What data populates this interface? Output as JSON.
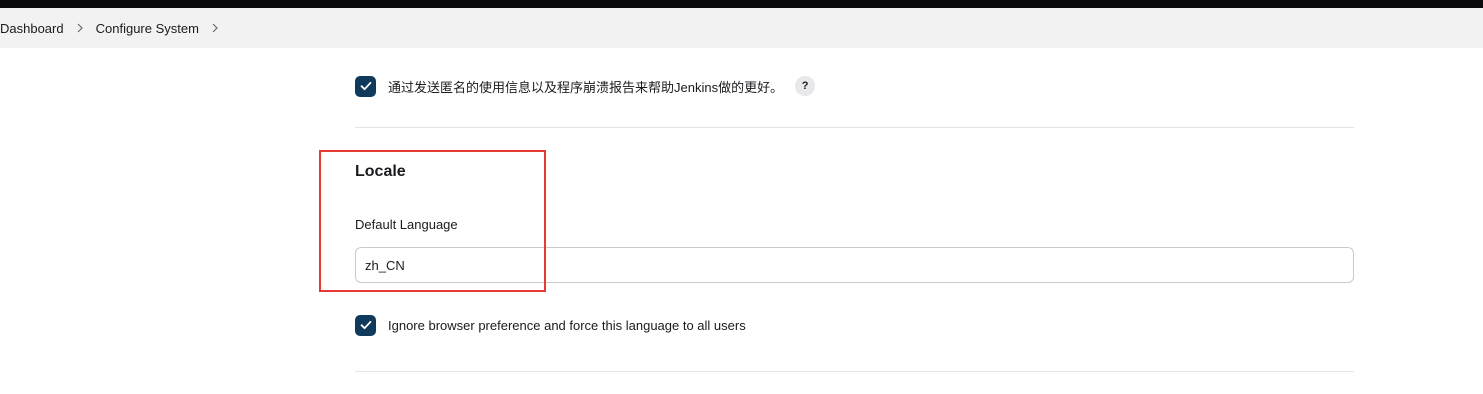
{
  "breadcrumb": {
    "items": [
      {
        "label": "Dashboard"
      },
      {
        "label": "Configure System"
      }
    ]
  },
  "usage_stats": {
    "label": "通过发送匿名的使用信息以及程序崩溃报告来帮助Jenkins做的更好。",
    "checked": true,
    "help_label": "?"
  },
  "locale": {
    "title": "Locale",
    "default_language_label": "Default Language",
    "default_language_value": "zh_CN",
    "ignore_browser_label": "Ignore browser preference and force this language to all users",
    "ignore_browser_checked": true
  },
  "colors": {
    "checkbox": "#0f3a5c",
    "highlight": "#e53935",
    "breadcrumb_bg": "#f2f2f3",
    "top_strip": "#0b0b0d"
  },
  "icons": {
    "breadcrumb_separator": "chevron-right-icon",
    "checkbox_mark": "check-icon"
  }
}
